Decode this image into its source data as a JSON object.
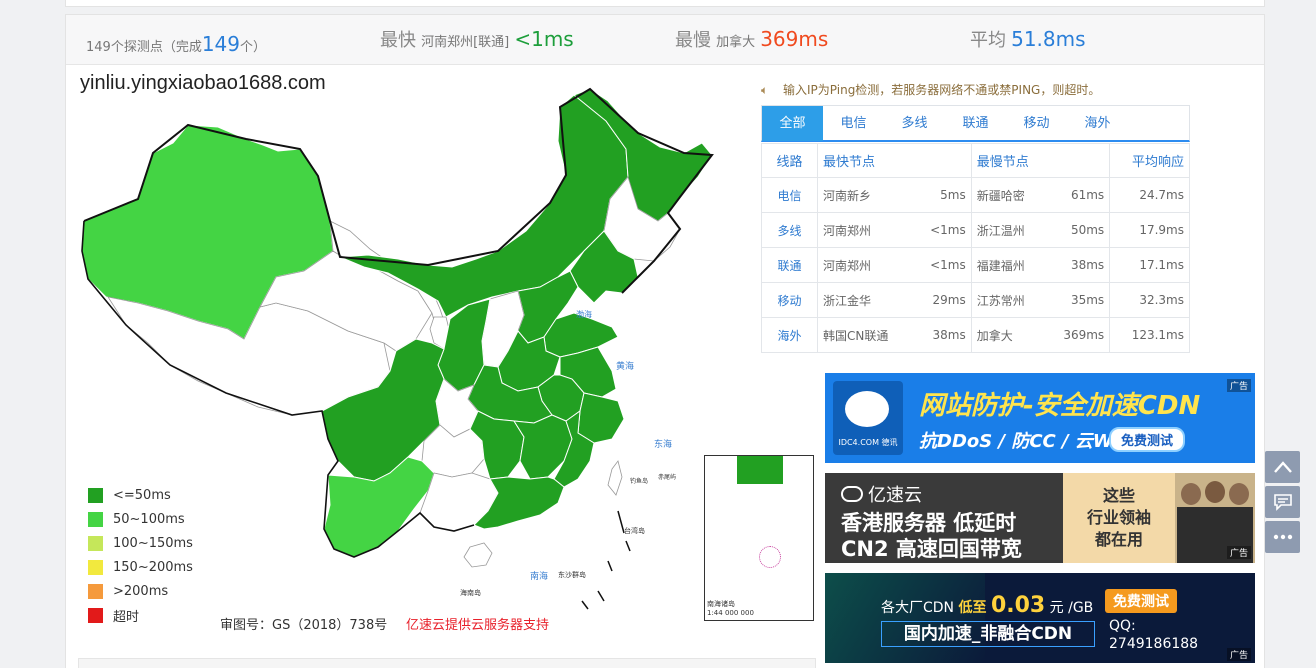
{
  "stats": {
    "total_prefix": "149个探测点（完成",
    "total_count": "149",
    "total_suffix": "个）",
    "fastest_label": "最快",
    "fastest_node": "河南郑州[联通]",
    "fastest_value": "<1ms",
    "slowest_label": "最慢",
    "slowest_node": "加拿大",
    "slowest_value": "369ms",
    "avg_label": "平均",
    "avg_value": "51.8ms"
  },
  "domain": "yinliu.yingxiaobao1688.com",
  "legend": [
    {
      "label": "<=50ms",
      "color": "#22a022"
    },
    {
      "label": "50~100ms",
      "color": "#44d444"
    },
    {
      "label": "100~150ms",
      "color": "#c5e75a"
    },
    {
      "label": "150~200ms",
      "color": "#f2e93e"
    },
    {
      "label": ">200ms",
      "color": "#f59a3c"
    },
    {
      "label": "超时",
      "color": "#e21a1a"
    }
  ],
  "map_footer": {
    "approval": "审图号：GS（2018）738号",
    "provider": "亿速云提供云服务器支持"
  },
  "map_labels": {
    "sea_huang": "黄海",
    "sea_dong": "东海",
    "sea_nan": "南海",
    "taiwan": "台湾岛",
    "hainan": "海南岛",
    "dongsha": "东沙群岛",
    "diaoyu": "钓鱼岛",
    "chiwei": "赤尾屿",
    "inset_title": "南海诸岛",
    "inset_scale": "1:44 000 000"
  },
  "notice": "输入IP为Ping检测，若服务器网络不通或禁PING，则超时。",
  "tabs": [
    "全部",
    "电信",
    "多线",
    "联通",
    "移动",
    "海外"
  ],
  "table": {
    "headers": {
      "isp": "线路",
      "fastest": "最快节点",
      "slowest": "最慢节点",
      "avg": "平均响应"
    },
    "rows": [
      {
        "isp": "电信",
        "fast_node": "河南新乡",
        "fast_ms": "5ms",
        "slow_node": "新疆哈密",
        "slow_ms": "61ms",
        "avg": "24.7ms"
      },
      {
        "isp": "多线",
        "fast_node": "河南郑州",
        "fast_ms": "<1ms",
        "slow_node": "浙江温州",
        "slow_ms": "50ms",
        "avg": "17.9ms"
      },
      {
        "isp": "联通",
        "fast_node": "河南郑州",
        "fast_ms": "<1ms",
        "slow_node": "福建福州",
        "slow_ms": "38ms",
        "avg": "17.1ms"
      },
      {
        "isp": "移动",
        "fast_node": "浙江金华",
        "fast_ms": "29ms",
        "slow_node": "江苏常州",
        "slow_ms": "35ms",
        "avg": "32.3ms"
      },
      {
        "isp": "海外",
        "fast_node": "韩国CN联通",
        "fast_ms": "38ms",
        "slow_node": "加拿大",
        "slow_ms": "369ms",
        "avg": "123.1ms"
      }
    ]
  },
  "ads": {
    "tag": "广告",
    "ad1": {
      "logo": "IDC4.COM 德讯",
      "title": "网站防护-安全加速CDN",
      "sub": "抗DDoS / 防CC / 云WAF",
      "btn": "免费测试"
    },
    "ad2": {
      "brand": "亿速云",
      "line1": "香港服务器  低延时",
      "line2": "CN2 高速回国带宽",
      "side": "这些\n行业领袖\n都在用"
    },
    "ad3": {
      "text1": "各大厂CDN",
      "low": "低至",
      "price": "0.03",
      "unit": "元 /GB",
      "btn": "免费测试",
      "line2": "国内加速_非融合CDN",
      "qq_label": "QQ:",
      "qq": "2749186188"
    }
  },
  "colors": {
    "link": "#2f7bd0",
    "fast": "#1d9e3b",
    "slow": "#f04a1f",
    "avg": "#2a7ed8",
    "tab_active": "#2d9ee8"
  }
}
